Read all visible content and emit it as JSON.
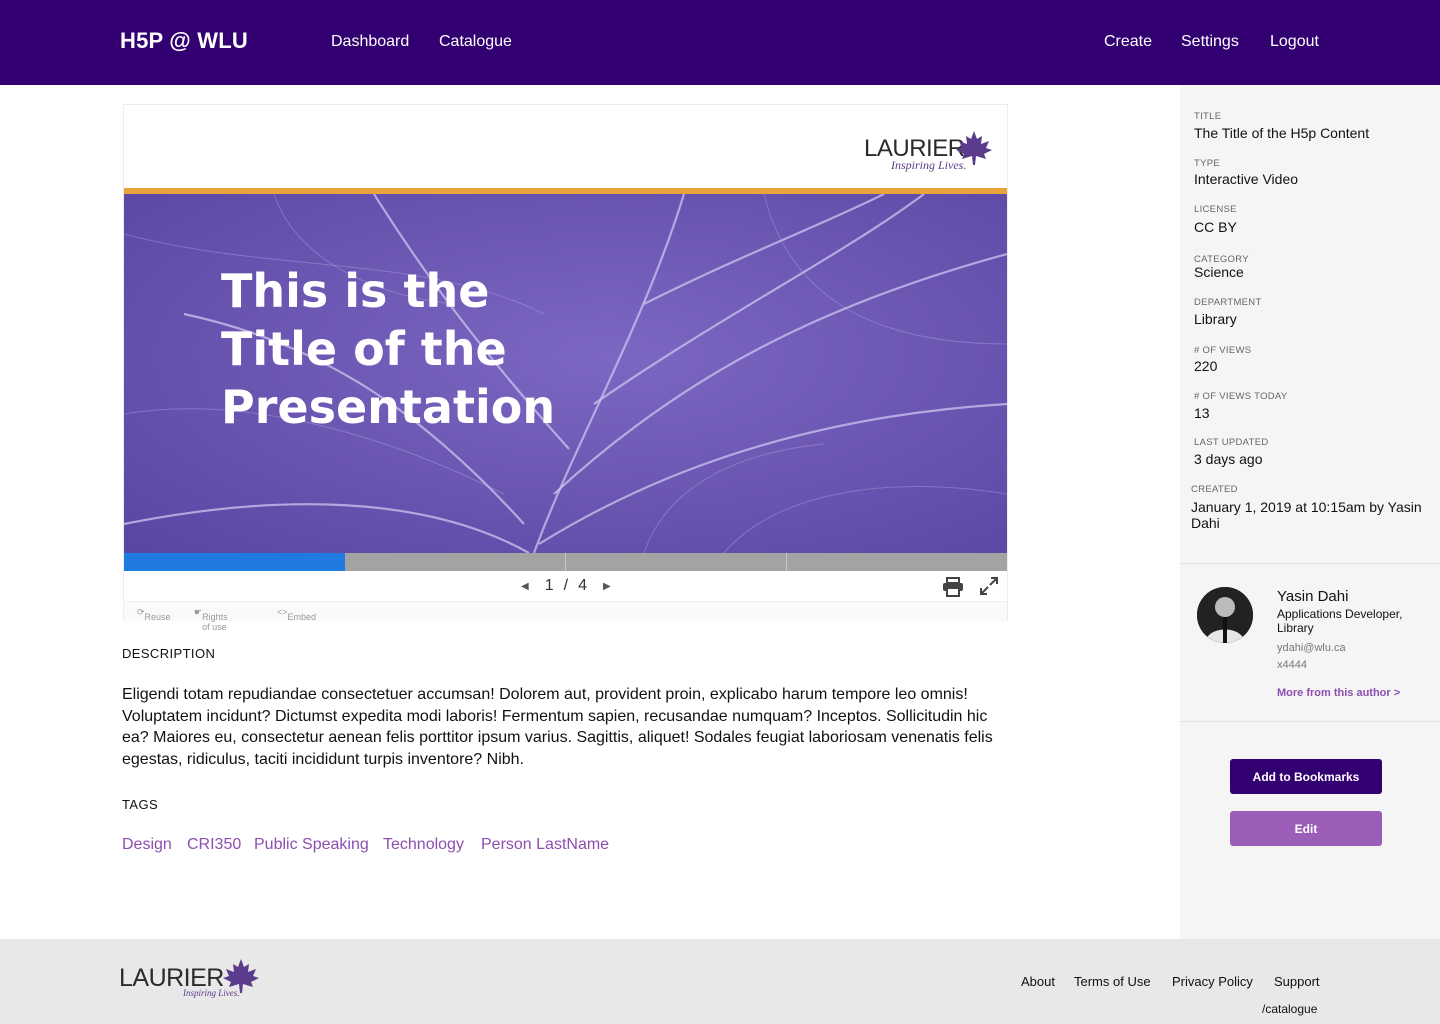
{
  "header": {
    "brand": "H5P @ WLU",
    "nav_left": [
      "Dashboard",
      "Catalogue"
    ],
    "nav_right": [
      "Create",
      "Settings",
      "Logout"
    ]
  },
  "player": {
    "logo_word": "LAURIER",
    "logo_tagline": "Inspiring Lives.",
    "slide_title_lines": [
      "This is the",
      "Title of the",
      "Presentation"
    ],
    "current_slide": "1",
    "separator": "/",
    "total_slides": "4",
    "progress_fraction": 0.25,
    "actions": [
      "Reuse",
      "Rights of use",
      "Embed"
    ]
  },
  "description": {
    "heading": "DESCRIPTION",
    "text": "Eligendi totam repudiandae consectetuer accumsan! Dolorem aut, provident proin, explicabo harum tempore leo omnis! Voluptatem incidunt? Dictumst expedita modi laboris! Fermentum sapien, recusandae numquam? Inceptos. Sollicitudin hic ea? Maiores eu, consectetur aenean felis porttitor ipsum varius. Sagittis, aliquet! Sodales feugiat laboriosam venenatis felis egestas, ridiculus, taciti incididunt turpis inventore? Nibh."
  },
  "tags": {
    "heading": "TAGS",
    "items": [
      "Design",
      "CRI350",
      "Public Speaking",
      "Technology",
      "Person LastName"
    ]
  },
  "meta": [
    {
      "label": "TITLE",
      "value": "The Title of the H5p Content"
    },
    {
      "label": "TYPE",
      "value": "Interactive Video"
    },
    {
      "label": "LICENSE",
      "value": "CC BY"
    },
    {
      "label": "CATEGORY",
      "value": "Science"
    },
    {
      "label": "DEPARTMENT",
      "value": "Library"
    },
    {
      "label": "# OF VIEWS",
      "value": "220"
    },
    {
      "label": "# OF VIEWS TODAY",
      "value": "13"
    },
    {
      "label": "LAST UPDATED",
      "value": "3 days ago"
    },
    {
      "label": "CREATED",
      "value": "January 1, 2019 at 10:15am by Yasin Dahi"
    }
  ],
  "author": {
    "name": "Yasin Dahi",
    "role": "Applications Developer, Library",
    "email": "ydahi@wlu.ca",
    "ext": "x4444",
    "more_link": "More from this author >"
  },
  "buttons": {
    "bookmark": "Add to Bookmarks",
    "edit": "Edit"
  },
  "footer": {
    "logo_word": "LAURIER",
    "logo_tagline": "Inspiring Lives.",
    "links": [
      "About",
      "Terms of Use",
      "Privacy Policy",
      "Support"
    ],
    "path": "/catalogue"
  },
  "colors": {
    "brand_purple": "#330072",
    "accent_purple": "#8c4fb0",
    "progress_blue": "#1f7bdf",
    "stripe_gold": "#e8a33a"
  }
}
